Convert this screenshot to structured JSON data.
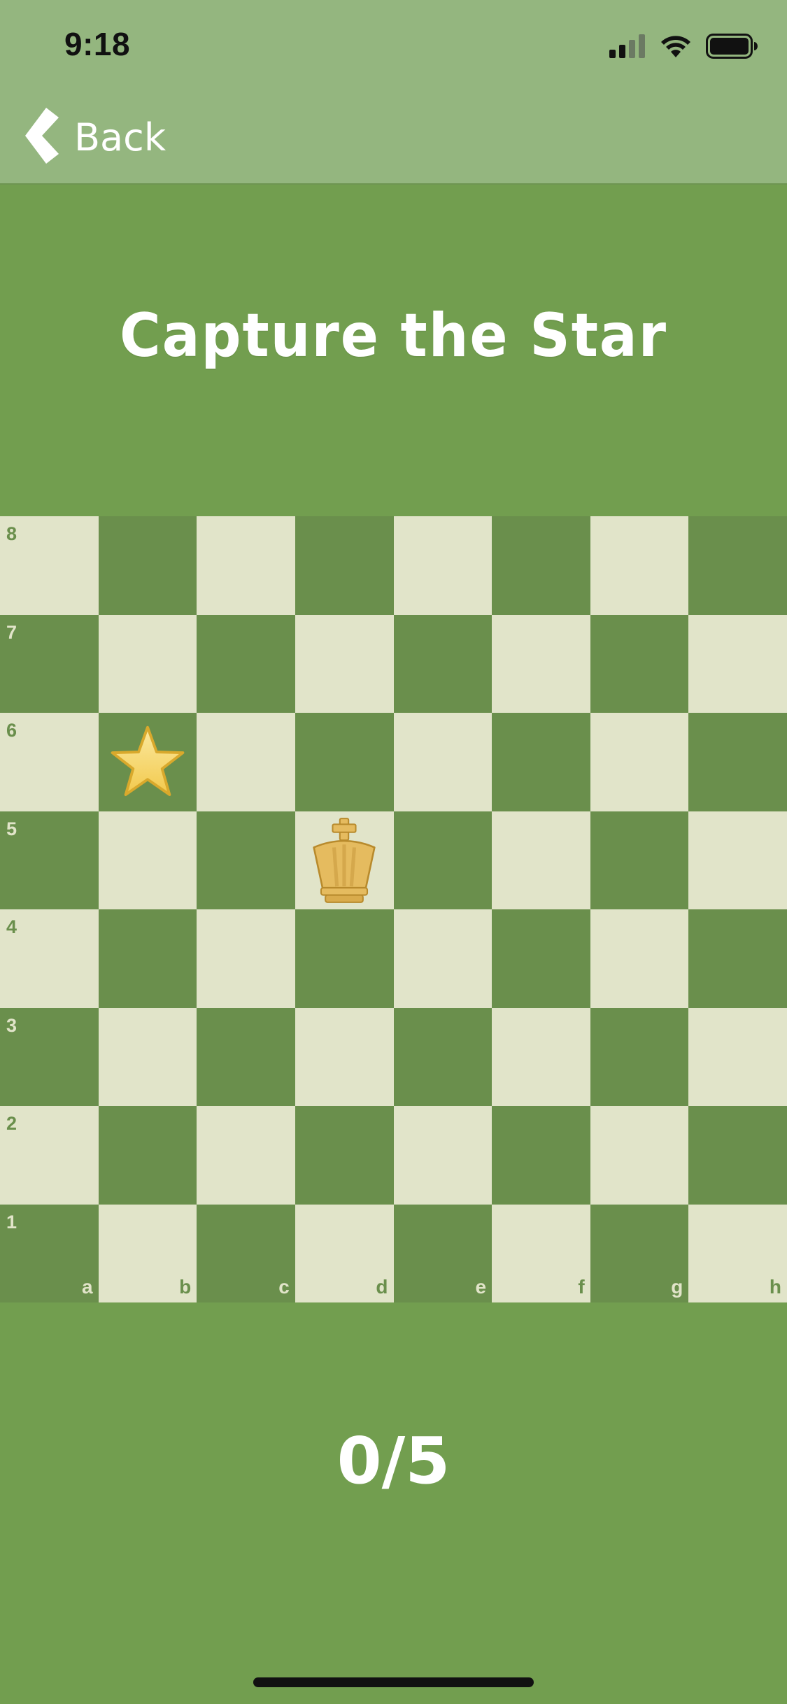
{
  "status_bar": {
    "time": "9:18",
    "icons": [
      "signal-icon",
      "wifi-icon",
      "battery-icon"
    ]
  },
  "nav": {
    "back_label": "Back",
    "back_icon": "chevron-left-icon"
  },
  "title": "Capture the Star",
  "board": {
    "files": [
      "a",
      "b",
      "c",
      "d",
      "e",
      "f",
      "g",
      "h"
    ],
    "ranks": [
      "8",
      "7",
      "6",
      "5",
      "4",
      "3",
      "2",
      "1"
    ],
    "light_color": "#e1e4c9",
    "dark_color": "#6a8f4c",
    "pieces": [
      {
        "square": "b6",
        "type": "star",
        "icon": "star-icon"
      },
      {
        "square": "d5",
        "type": "king",
        "icon": "king-icon"
      }
    ]
  },
  "score": "0/5",
  "colors": {
    "background": "#729e4f",
    "header": "#94b67f"
  }
}
